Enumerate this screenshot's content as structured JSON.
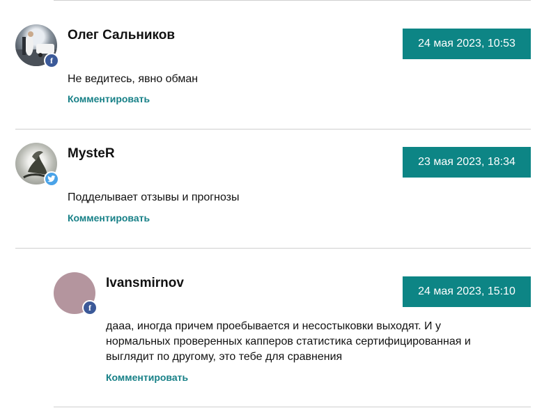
{
  "theme": {
    "accent": "#0d8585",
    "link": "#178087",
    "facebook": "#3b5998",
    "twitter": "#4aa3e8"
  },
  "comments": [
    {
      "author": "Олег Сальников",
      "date": "24 мая 2023, 10:53",
      "text": "Не ведитесь, явно обман",
      "reply_label": "Комментировать",
      "social": "f",
      "social_icon": "facebook-icon"
    },
    {
      "author": "MysteR",
      "date": "23 мая 2023, 18:34",
      "text": "Подделывает отзывы и прогнозы",
      "reply_label": "Комментировать",
      "social": "twitter",
      "social_icon": "twitter-icon"
    },
    {
      "author": "Ivansmirnov",
      "date": "24 мая 2023, 15:10",
      "text": "дааа, иногда причем проебывается и несостыковки выходят. И у нормальных проверенных капперов статистика сертифицированная и выглядит по другому, это тебе для сравнения",
      "reply_label": "Комментировать",
      "social": "f",
      "social_icon": "facebook-icon"
    }
  ]
}
